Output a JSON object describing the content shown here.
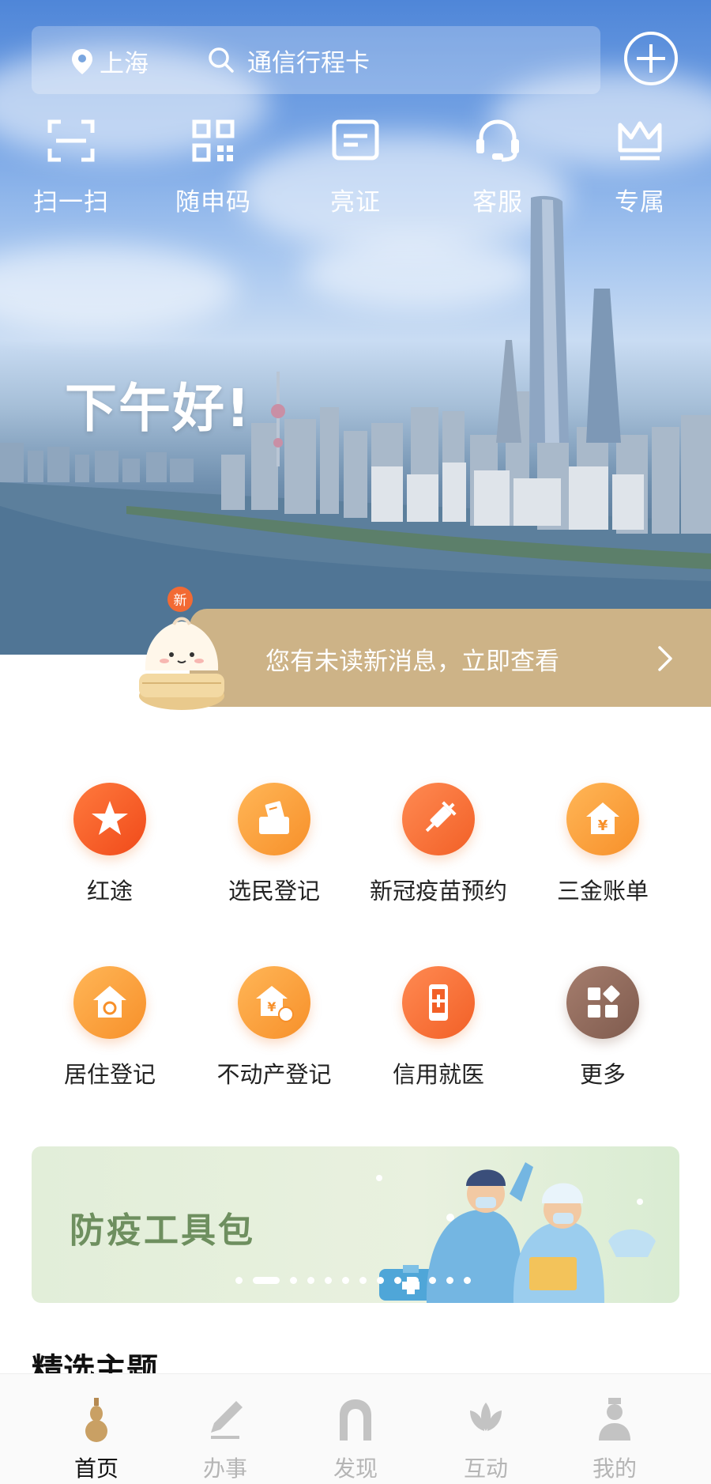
{
  "header": {
    "location": "上海",
    "search_placeholder": "通信行程卡"
  },
  "quick_actions": [
    {
      "label": "扫一扫",
      "icon": "scan-icon"
    },
    {
      "label": "随申码",
      "icon": "qr-code-icon"
    },
    {
      "label": "亮证",
      "icon": "id-card-icon"
    },
    {
      "label": "客服",
      "icon": "headset-icon"
    },
    {
      "label": "专属",
      "icon": "crown-icon"
    }
  ],
  "greeting": "下午好!",
  "notice": {
    "badge": "新",
    "text": "您有未读新消息，立即查看"
  },
  "services": [
    {
      "label": "红途",
      "icon": "red-star-icon"
    },
    {
      "label": "选民登记",
      "icon": "ballot-box-icon"
    },
    {
      "label": "新冠疫苗预约",
      "icon": "syringe-icon"
    },
    {
      "label": "三金账单",
      "icon": "house-yuan-icon"
    },
    {
      "label": "居住登记",
      "icon": "home-icon"
    },
    {
      "label": "不动产登记",
      "icon": "property-icon"
    },
    {
      "label": "信用就医",
      "icon": "phone-medical-icon"
    },
    {
      "label": "更多",
      "icon": "more-apps-icon"
    }
  ],
  "banner": {
    "title": "防疫工具包",
    "slide_count": 13,
    "active_slide": 2
  },
  "section_title": "精选主题",
  "tabs": [
    {
      "label": "首页",
      "icon": "gourd-icon",
      "active": true
    },
    {
      "label": "办事",
      "icon": "pen-nib-icon",
      "active": false
    },
    {
      "label": "发现",
      "icon": "arch-icon",
      "active": false
    },
    {
      "label": "互动",
      "icon": "lotus-icon",
      "active": false
    },
    {
      "label": "我的",
      "icon": "person-icon",
      "active": false
    }
  ],
  "colors": {
    "accent": "#cdb387",
    "tab_active": "#111111",
    "tab_inactive": "#b5b5b5"
  }
}
